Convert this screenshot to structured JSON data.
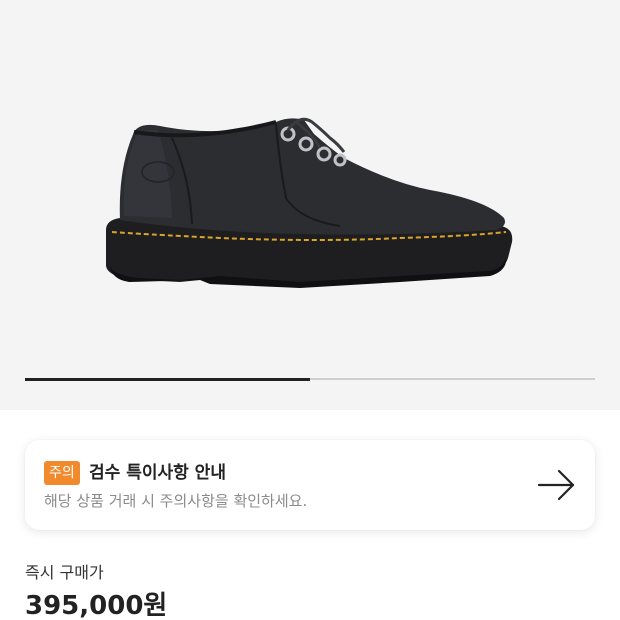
{
  "product": {
    "image_icon": "black-leather-derby-shoe"
  },
  "gallery": {
    "progress_fraction": 0.5
  },
  "notice": {
    "badge": "주의",
    "title": "검수 특이사항 안내",
    "description": "해당 상품 거래 시 주의사항을 확인하세요.",
    "arrow_icon": "arrow-right-icon",
    "badge_color": "#f08a2c"
  },
  "price": {
    "label": "즉시 구매가",
    "value": "395,000원"
  }
}
